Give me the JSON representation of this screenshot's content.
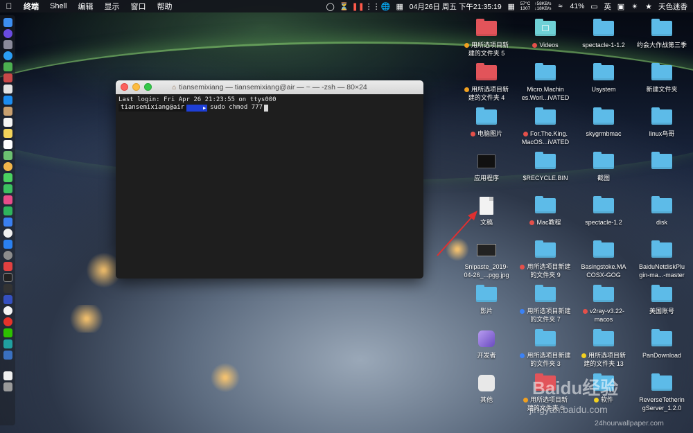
{
  "menubar": {
    "app_name": "终端",
    "menus": [
      "Shell",
      "编辑",
      "显示",
      "窗口",
      "帮助"
    ],
    "status": {
      "temp_fan": [
        "57°C",
        "1307"
      ],
      "net_up": "58KB/s",
      "net_down": "18KB/s",
      "datetime": "04月26日 周五 下午21:35:19",
      "battery": "41%",
      "input_method": "英",
      "user": "天色迷香"
    }
  },
  "terminal": {
    "title": "tiansemixiang — tiansemixiang@air — ~ — -zsh — 80×24",
    "last_login": "Last login: Fri Apr 26 21:23:55 on ttys000",
    "prompt_user": "tiansemixiang@air",
    "command": "sudo chmod 777"
  },
  "desktop": {
    "icons": [
      {
        "label": [
          "用所选项目新",
          "建的文件夹 5"
        ],
        "tag": "#f0a020",
        "type": "red"
      },
      {
        "label": [
          "Videos"
        ],
        "tag": "#e5504a",
        "type": "teal"
      },
      {
        "label": [
          "spectacle-1-1.2"
        ],
        "tag": "",
        "type": "folder"
      },
      {
        "label": [
          "约会大作战第三季"
        ],
        "tag": "",
        "type": "folder"
      },
      {
        "label": [
          "用所选项目新",
          "建的文件夹 4"
        ],
        "tag": "#f0a020",
        "type": "red"
      },
      {
        "label": [
          "Micro.Machin",
          "es.Worl...iVATED"
        ],
        "tag": "",
        "type": "folder"
      },
      {
        "label": [
          "Usystem"
        ],
        "tag": "",
        "type": "folder"
      },
      {
        "label": [
          "新建文件夹"
        ],
        "tag": "",
        "type": "folder"
      },
      {
        "label": [
          "电脑图片"
        ],
        "tag": "#e5504a",
        "type": "folder"
      },
      {
        "label": [
          "For.The.King.",
          "MacOS...iVATED"
        ],
        "tag": "#e5504a",
        "type": "folder"
      },
      {
        "label": [
          "skygrmbmac"
        ],
        "tag": "",
        "type": "folder"
      },
      {
        "label": [
          "linux鸟哥"
        ],
        "tag": "",
        "type": "folder"
      },
      {
        "label": [
          "应用程序"
        ],
        "tag": "",
        "type": "dark"
      },
      {
        "label": [
          "$RECYCLE.BIN"
        ],
        "tag": "",
        "type": "folder"
      },
      {
        "label": [
          "截图"
        ],
        "tag": "",
        "type": "folder"
      },
      {
        "label": [
          ""
        ],
        "tag": "",
        "type": "folder"
      },
      {
        "label": [
          "文稿"
        ],
        "tag": "",
        "type": "doc"
      },
      {
        "label": [
          "Mac教程"
        ],
        "tag": "#e5504a",
        "type": "folder"
      },
      {
        "label": [
          "spectacle-1.2"
        ],
        "tag": "",
        "type": "folder"
      },
      {
        "label": [
          "disk"
        ],
        "tag": "",
        "type": "folder"
      },
      {
        "label": [
          "Snipaste_2019-",
          "04-26_...pgg.jpg"
        ],
        "tag": "",
        "type": "screen"
      },
      {
        "label": [
          "用所选项目新建",
          "的文件夹 9"
        ],
        "tag": "#e5504a",
        "type": "folder"
      },
      {
        "label": [
          "Basingstoke.MA",
          "COSX-GOG"
        ],
        "tag": "",
        "type": "folder"
      },
      {
        "label": [
          "BaiduNetdiskPlu",
          "gin-ma...-master"
        ],
        "tag": "",
        "type": "folder"
      },
      {
        "label": [
          "影片"
        ],
        "tag": "",
        "type": "folder"
      },
      {
        "label": [
          "用所选项目新建",
          "的文件夹 7"
        ],
        "tag": "#3b82f6",
        "type": "folder"
      },
      {
        "label": [
          "v2ray-v3.22-",
          "macos"
        ],
        "tag": "#e5504a",
        "type": "folder"
      },
      {
        "label": [
          "美国账号"
        ],
        "tag": "",
        "type": "folder"
      },
      {
        "label": [
          "开发者"
        ],
        "tag": "",
        "type": "app-purple"
      },
      {
        "label": [
          "用所选项目新建",
          "的文件夹 3"
        ],
        "tag": "#3b82f6",
        "type": "folder"
      },
      {
        "label": [
          "用所选项目新",
          "建的文件夹 13"
        ],
        "tag": "#f2d020",
        "type": "folder"
      },
      {
        "label": [
          "PanDownload"
        ],
        "tag": "",
        "type": "folder"
      },
      {
        "label": [
          "其他"
        ],
        "tag": "",
        "type": "app-white"
      },
      {
        "label": [
          "用所选项目新",
          "建的文件夹 6"
        ],
        "tag": "#f0a020",
        "type": "red"
      },
      {
        "label": [
          "软件"
        ],
        "tag": "#f2d020",
        "type": "folder"
      },
      {
        "label": [
          "ReverseTetherin",
          "gServer_1.2.0"
        ],
        "tag": "",
        "type": "folder"
      }
    ]
  },
  "watermark": {
    "brand": "Baidu经验",
    "sub": "jingyan.baidu.com",
    "site": "24hourwallpaper.com"
  },
  "colors": {
    "folder_blue": "#5dbbe8",
    "folder_red": "#e2545a",
    "arrow_red": "#e03030"
  }
}
